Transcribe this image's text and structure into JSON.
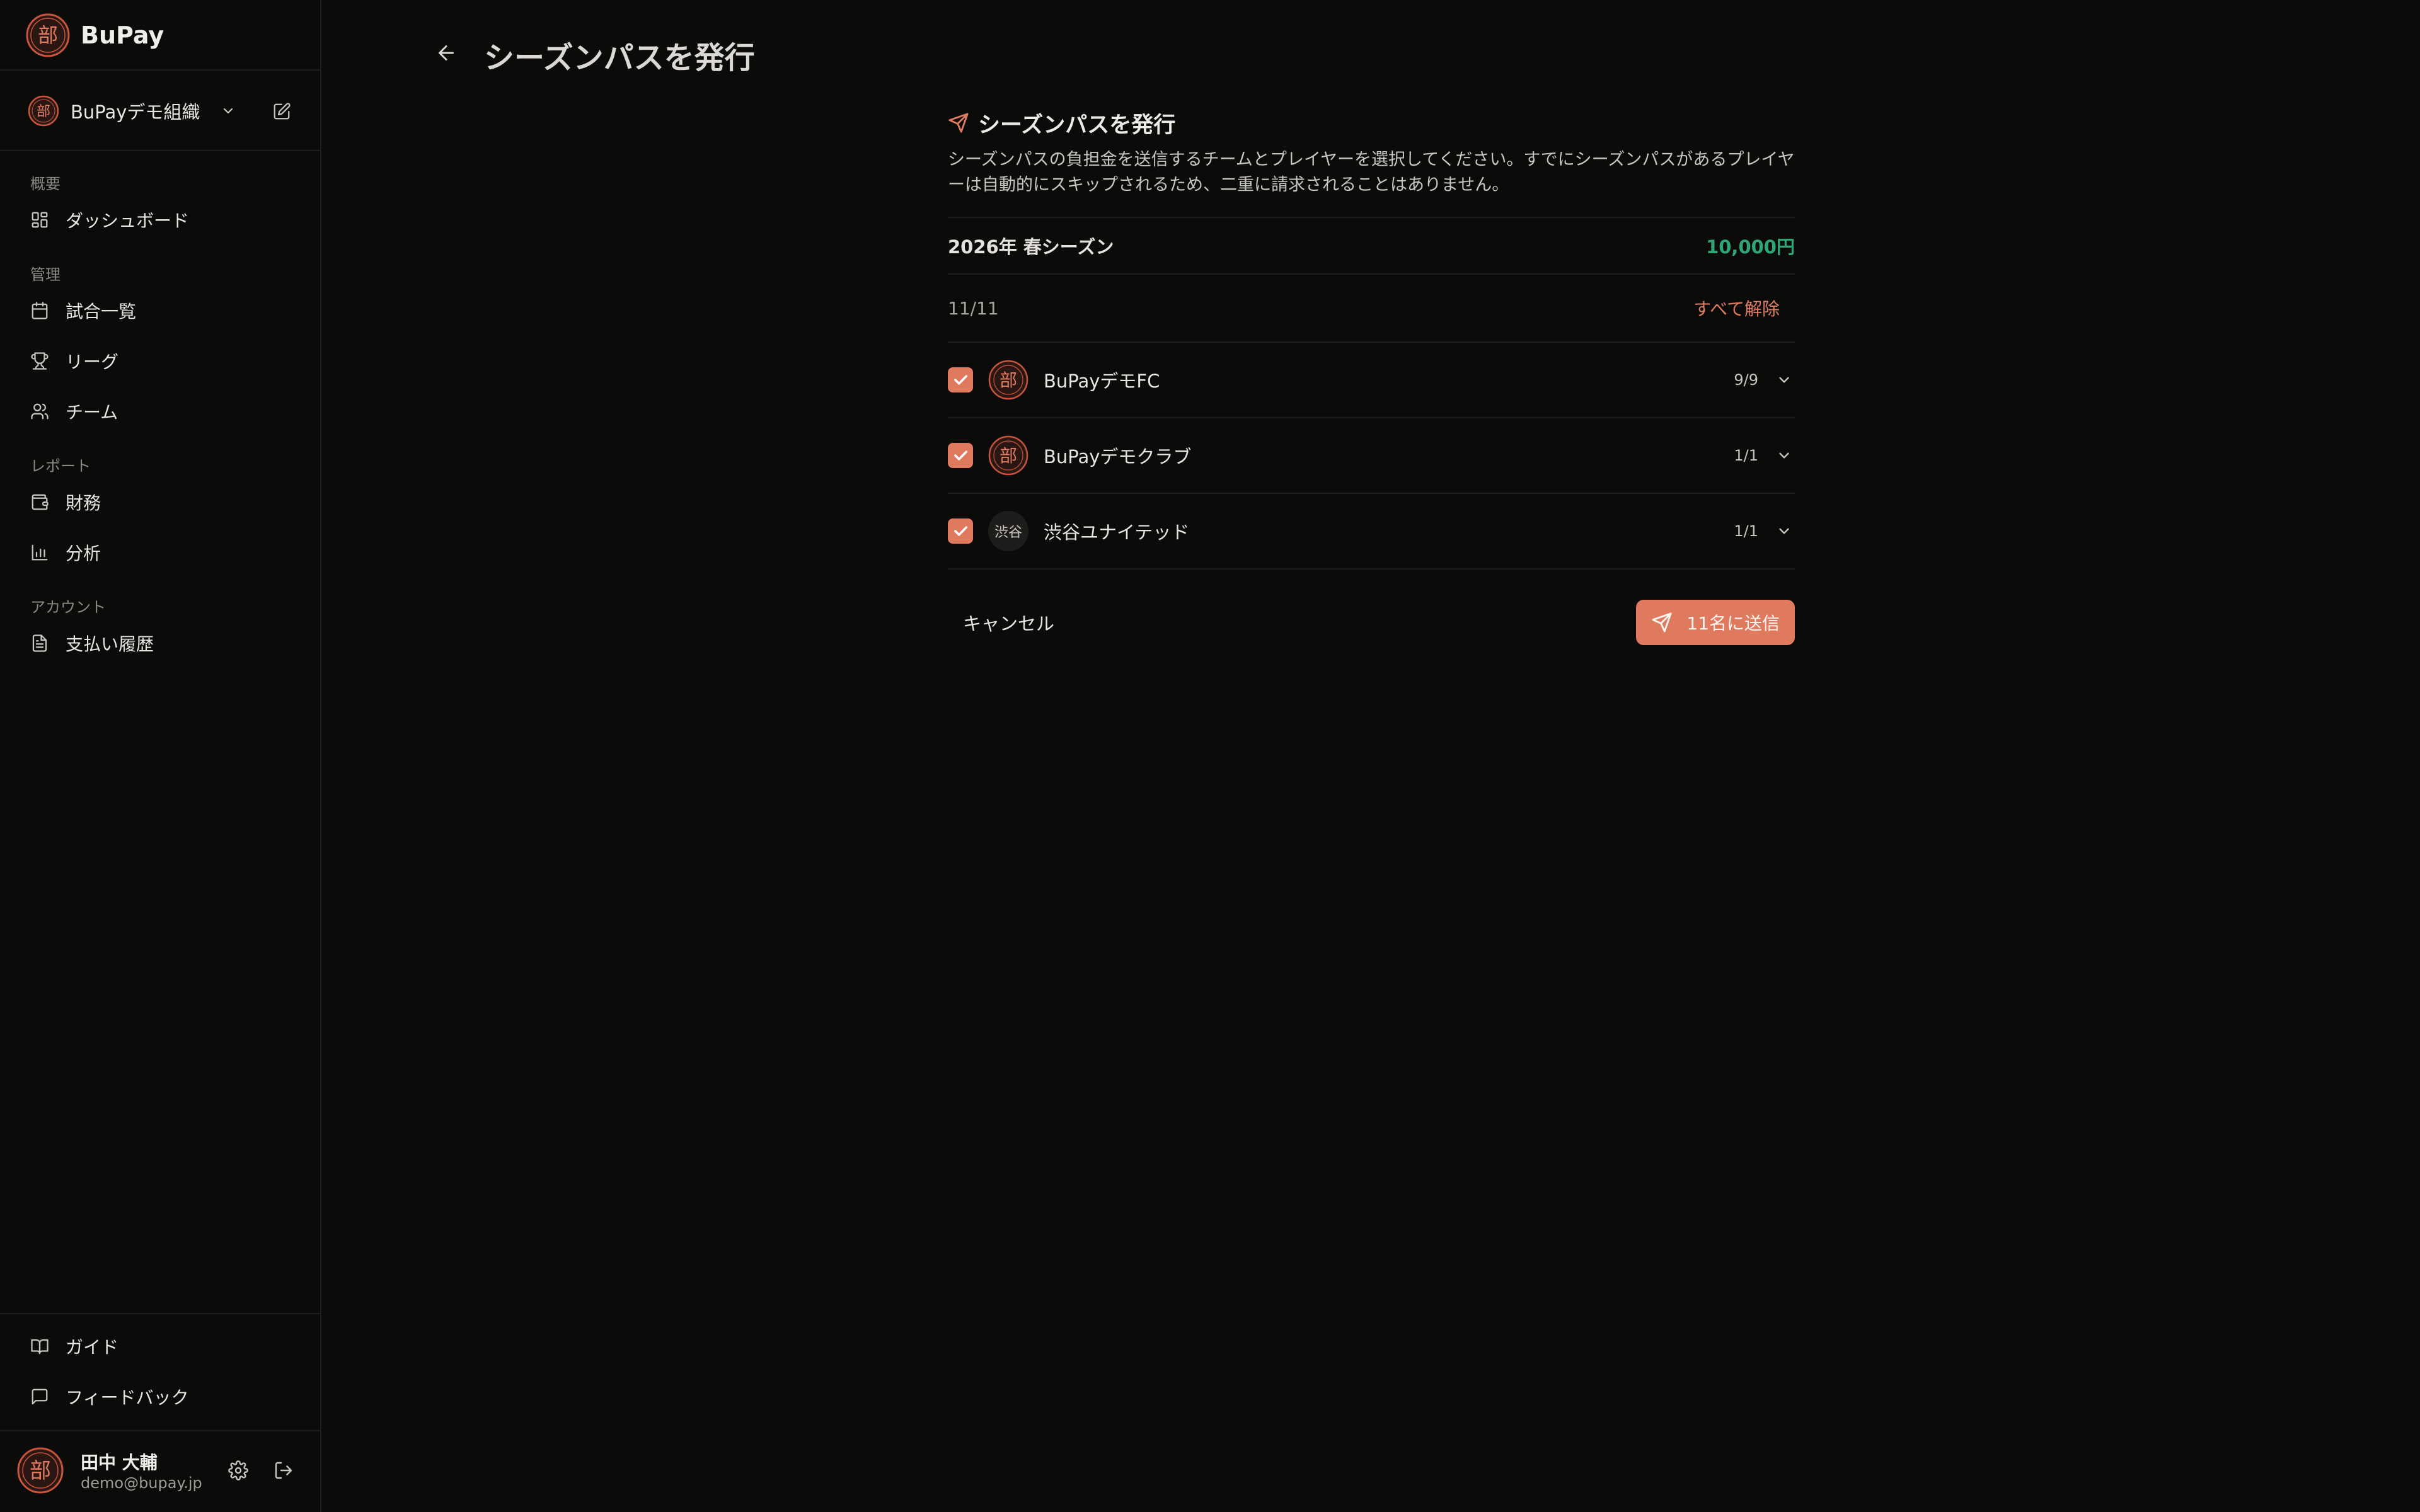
{
  "app": {
    "name": "BuPay"
  },
  "org": {
    "name": "BuPayデモ組織"
  },
  "nav": {
    "sections": [
      {
        "label": "概要",
        "items": [
          {
            "label": "ダッシュボード"
          }
        ]
      },
      {
        "label": "管理",
        "items": [
          {
            "label": "試合一覧"
          },
          {
            "label": "リーグ"
          },
          {
            "label": "チーム"
          }
        ]
      },
      {
        "label": "レポート",
        "items": [
          {
            "label": "財務"
          },
          {
            "label": "分析"
          }
        ]
      },
      {
        "label": "アカウント",
        "items": [
          {
            "label": "支払い履歴"
          }
        ]
      }
    ],
    "bottom": [
      {
        "label": "ガイド"
      },
      {
        "label": "フィードバック"
      }
    ]
  },
  "user": {
    "name": "田中 大輔",
    "email": "demo@bupay.jp"
  },
  "page": {
    "title": "シーズンパスを発行"
  },
  "panel": {
    "title": "シーズンパスを発行",
    "description": "シーズンパスの負担金を送信するチームとプレイヤーを選択してください。すでにシーズンパスがあるプレイヤーは自動的にスキップされるため、二重に請求されることはありません。",
    "season": {
      "name": "2026年 春シーズン",
      "price": "10,000円"
    },
    "selection": {
      "count": "11/11",
      "clear_label": "すべて解除"
    },
    "teams": [
      {
        "name": "BuPayデモFC",
        "count": "9/9",
        "logo_text": "部"
      },
      {
        "name": "BuPayデモクラブ",
        "count": "1/1",
        "logo_text": "部"
      },
      {
        "name": "渋谷ユナイテッド",
        "count": "1/1",
        "logo_text": "渋谷"
      }
    ],
    "cancel_label": "キャンセル",
    "send_label": "11名に送信"
  },
  "colors": {
    "accent": "#e07a5f",
    "price": "#2ea67a",
    "background": "#0b0b0a"
  },
  "logo_glyph": "部"
}
